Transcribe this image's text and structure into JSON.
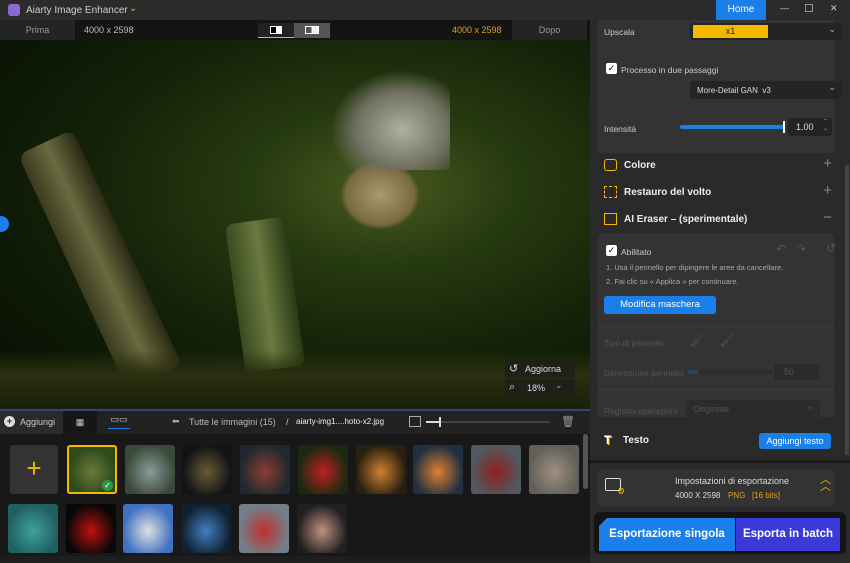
{
  "title_bar": {
    "app_name": "Aiarty Image Enhancer",
    "home_label": "Home",
    "minimize": "—",
    "maximize": "☐",
    "close": "✕"
  },
  "compare_bar": {
    "before_label": "Prima",
    "before_size": "4000 x 2598",
    "after_size": "4000 x 2598",
    "after_label": "Dopo"
  },
  "preview": {
    "refresh_label": "Aggiorna",
    "zoom_value": "18%"
  },
  "toolbar": {
    "add_label": "Aggiungi",
    "all_images": "Tutte le immagini (15)",
    "separator": "/",
    "current_file": "aiarty-img1....hoto-x2.jpg"
  },
  "thumbnails": {
    "count": 15,
    "selected_index": 0,
    "colors": [
      [
        "#2d4a1a",
        "#6b7a3a"
      ],
      [
        "#3a4a3a",
        "#8a9a9a"
      ],
      [
        "#101418",
        "#6a5a30"
      ],
      [
        "#202830",
        "#8a4030"
      ],
      [
        "#1a2a10",
        "#c02020"
      ],
      [
        "#2a2010",
        "#d08030"
      ],
      [
        "#203040",
        "#e08030"
      ],
      [
        "#505a60",
        "#902020"
      ],
      [
        "#606058",
        "#a09080"
      ],
      [
        "#206060",
        "#40a0a0"
      ],
      [
        "#080808",
        "#c01010"
      ],
      [
        "#4070c0",
        "#e0e0e0"
      ],
      [
        "#102030",
        "#4080c0"
      ],
      [
        "#70808a",
        "#c03030"
      ],
      [
        "#202020",
        "#c09080"
      ]
    ]
  },
  "panel": {
    "upscale_label": "Upscala",
    "upscale_value": "x1",
    "two_pass_label": "Processo in due passaggi",
    "model_value": "More-Detail GAN  v3",
    "intensity_label": "Intensità",
    "intensity_value": "1.00",
    "intensity_fraction": 1.0,
    "color_label": "Colore",
    "face_label": "Restauro del volto",
    "eraser_label": "AI Eraser – (sperimentale)",
    "enabled_label": "Abilitato",
    "step1": "1. Usa il pennello per dipingere le aree da cancellare.",
    "step2": "2. Fai clic su « Applica » per continuare.",
    "edit_mask_label": "Modifica maschera",
    "brush_type_label": "Tipo di pennello",
    "brush_size_label": "Dimensione pennello",
    "brush_size_value": "50",
    "history_label": "Registro operazioni",
    "history_value": "Originale",
    "text_label": "Testo",
    "add_text_label": "Aggiungi testo",
    "export_title": "Impostazioni di esportazione",
    "export_size": "4000 X 2598",
    "export_format": "PNG",
    "export_bits": "[16 bits]",
    "single_export": "Esportazione singola",
    "batch_export": "Esporta in batch"
  },
  "colors": {
    "accent_blue": "#1a7fe8",
    "accent_yellow": "#f5b800",
    "batch_purple": "#3a3ad8"
  }
}
